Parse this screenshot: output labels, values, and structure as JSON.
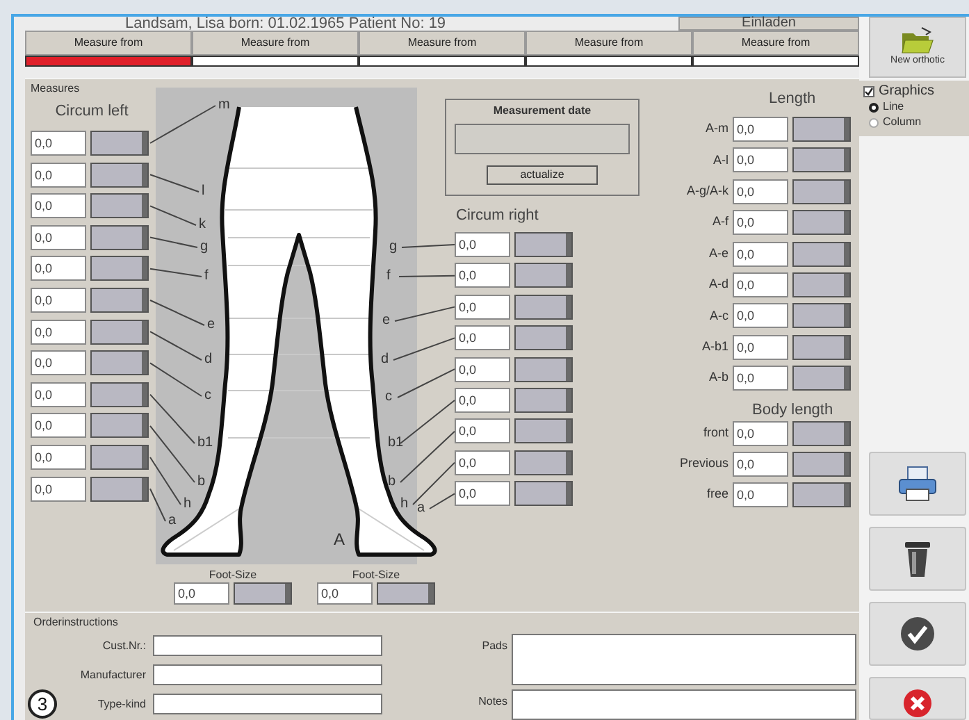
{
  "header": {
    "patient": "Landsam, Lisa born: 01.02.1965  Patient No: 19",
    "load_button": "Einladen"
  },
  "tabs": [
    {
      "label": "Measure from",
      "selected": true
    },
    {
      "label": "Measure from",
      "selected": false
    },
    {
      "label": "Measure from",
      "selected": false
    },
    {
      "label": "Measure from",
      "selected": false
    },
    {
      "label": "Measure from",
      "selected": false
    }
  ],
  "measures": {
    "title": "Measures",
    "circum_left": {
      "title": "Circum left",
      "rows": [
        {
          "letter": "m",
          "value": "0,0"
        },
        {
          "letter": "l",
          "value": "0,0"
        },
        {
          "letter": "k",
          "value": "0,0"
        },
        {
          "letter": "g",
          "value": "0,0"
        },
        {
          "letter": "f",
          "value": "0,0"
        },
        {
          "letter": "e",
          "value": "0,0"
        },
        {
          "letter": "d",
          "value": "0,0"
        },
        {
          "letter": "c",
          "value": "0,0"
        },
        {
          "letter": "b1",
          "value": "0,0"
        },
        {
          "letter": "b",
          "value": "0,0"
        },
        {
          "letter": "h",
          "value": "0,0"
        },
        {
          "letter": "a",
          "value": "0,0"
        }
      ]
    },
    "diagram_label": "A",
    "foot_size": [
      {
        "label": "Foot-Size",
        "value": "0,0"
      },
      {
        "label": "Foot-Size",
        "value": "0,0"
      }
    ],
    "measurement_date": {
      "title": "Measurement date",
      "button": "actualize"
    },
    "circum_right": {
      "title": "Circum right",
      "rows": [
        {
          "letter": "g",
          "value": "0,0"
        },
        {
          "letter": "f",
          "value": "0,0"
        },
        {
          "letter": "e",
          "value": "0,0"
        },
        {
          "letter": "d",
          "value": "0,0"
        },
        {
          "letter": "c",
          "value": "0,0"
        },
        {
          "letter": "b1",
          "value": "0,0"
        },
        {
          "letter": "b",
          "value": "0,0"
        },
        {
          "letter": "h",
          "value": "0,0"
        },
        {
          "letter": "a",
          "value": "0,0"
        }
      ]
    },
    "length": {
      "title": "Length",
      "rows": [
        {
          "label": "A-m",
          "value": "0,0"
        },
        {
          "label": "A-l",
          "value": "0,0"
        },
        {
          "label": "A-g/A-k",
          "value": "0,0"
        },
        {
          "label": "A-f",
          "value": "0,0"
        },
        {
          "label": "A-e",
          "value": "0,0"
        },
        {
          "label": "A-d",
          "value": "0,0"
        },
        {
          "label": "A-c",
          "value": "0,0"
        },
        {
          "label": "A-b1",
          "value": "0,0"
        },
        {
          "label": "A-b",
          "value": "0,0"
        }
      ]
    },
    "body_length": {
      "title": "Body length",
      "rows": [
        {
          "label": "front",
          "value": "0,0"
        },
        {
          "label": "Previous",
          "value": "0,0"
        },
        {
          "label": "free",
          "value": "0,0"
        }
      ]
    }
  },
  "order_instructions": {
    "title": "Orderinstructions",
    "fields": [
      {
        "label": "Cust.Nr.:"
      },
      {
        "label": "Manufacturer"
      },
      {
        "label": "Type-kind"
      }
    ],
    "text_areas": [
      {
        "label": "Pads"
      },
      {
        "label": "Notes"
      }
    ]
  },
  "sidebar": {
    "new_button": "New orthotic",
    "graphics": {
      "label": "Graphics",
      "checked": true,
      "options": [
        {
          "label": "Line",
          "selected": true
        },
        {
          "label": "Column",
          "selected": false
        }
      ]
    },
    "actions": [
      {
        "kind": "print"
      },
      {
        "kind": "delete"
      },
      {
        "kind": "confirm"
      },
      {
        "kind": "cancel"
      }
    ]
  },
  "callout": "3"
}
